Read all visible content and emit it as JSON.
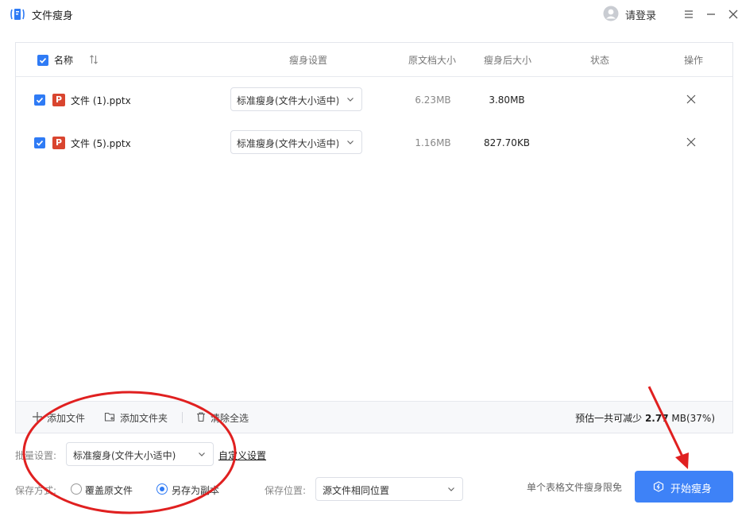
{
  "app": {
    "title": "文件瘦身",
    "login_label": "请登录"
  },
  "table": {
    "headers": {
      "name": "名称",
      "setting": "瘦身设置",
      "original": "原文档大小",
      "after": "瘦身后大小",
      "status": "状态",
      "action": "操作"
    },
    "rows": [
      {
        "name": "文件 (1).pptx",
        "setting": "标准瘦身(文件大小适中)",
        "original": "6.23MB",
        "after": "3.80MB",
        "status": ""
      },
      {
        "name": "文件 (5).pptx",
        "setting": "标准瘦身(文件大小适中)",
        "original": "1.16MB",
        "after": "827.70KB",
        "status": ""
      }
    ]
  },
  "toolbar": {
    "add_file": "添加文件",
    "add_folder": "添加文件夹",
    "clear_all": "清除全选",
    "estimate_prefix": "预估一共可减少 ",
    "estimate_value": "2.77",
    "estimate_suffix": " MB(37%)"
  },
  "settings": {
    "batch_label": "批量设置:",
    "batch_value": "标准瘦身(文件大小适中)",
    "custom_link": "自定义设置",
    "save_mode_label": "保存方式:",
    "overwrite_label": "覆盖原文件",
    "copy_label": "另存为副本",
    "save_mode_selected": "copy",
    "location_label": "保存位置:",
    "location_value": "源文件相同位置",
    "free_note": "单个表格文件瘦身限免",
    "start_label": "开始瘦身"
  },
  "colors": {
    "accent": "#3e82f7",
    "annotation": "#e02020",
    "ppt": "#d9452f"
  }
}
